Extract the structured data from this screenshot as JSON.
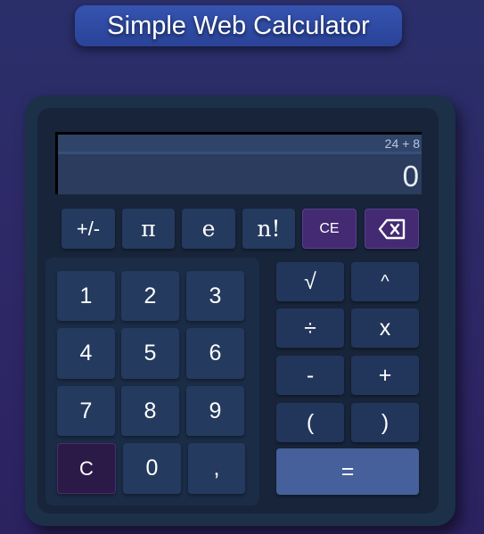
{
  "title": "Simple Web Calculator",
  "display": {
    "expression": "24 + 8",
    "value": "0"
  },
  "top_row": [
    "+/-",
    "π",
    "e",
    "n!",
    "CE"
  ],
  "backspace_icon": "backspace-icon",
  "digits": [
    "1",
    "2",
    "3",
    "4",
    "5",
    "6",
    "7",
    "8",
    "9",
    "C",
    "0",
    ","
  ],
  "operators": [
    "√",
    "^",
    "÷",
    "x",
    "-",
    "+",
    "(",
    ")"
  ],
  "equals": "="
}
